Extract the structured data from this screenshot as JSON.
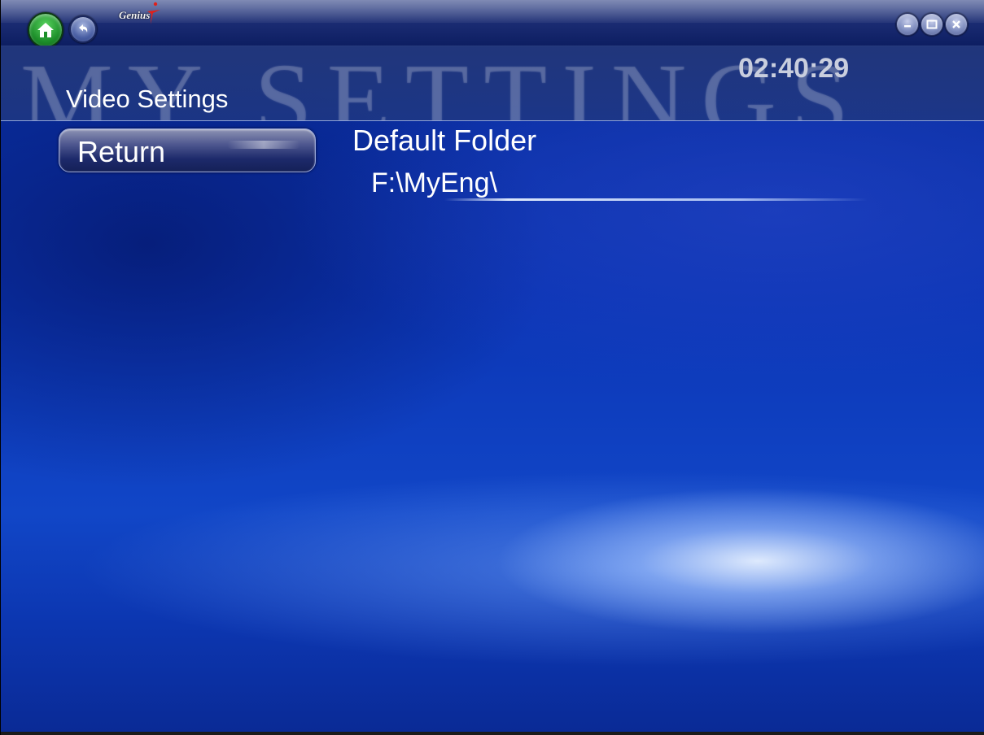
{
  "app": {
    "brand": "Genius",
    "brand_color": "#e0201a"
  },
  "header": {
    "watermark": "MY SETTINGS",
    "clock": "02:40:29",
    "section_title": "Video Settings"
  },
  "nav": {
    "return_label": "Return"
  },
  "settings": {
    "default_folder_label": "Default Folder",
    "default_folder_value": "F:\\MyEng\\"
  },
  "icons": {
    "home": "home-icon",
    "back": "back-arrow-icon",
    "minimize": "minimize-icon",
    "maximize": "maximize-icon",
    "close": "close-icon"
  }
}
